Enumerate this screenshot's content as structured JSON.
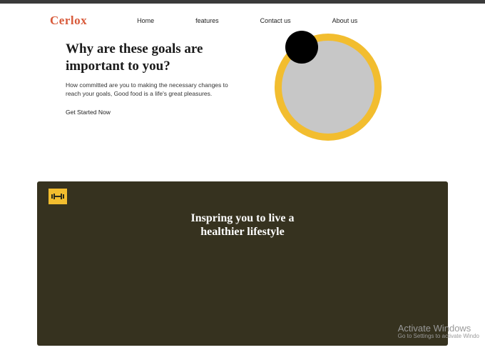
{
  "brand": "Cerlox",
  "nav": {
    "items": [
      "Home",
      "features",
      "Contact us",
      "About us"
    ]
  },
  "hero": {
    "title": "Why are these goals are important to you?",
    "subtitle": "How committed are you to making the necessary changes to reach your goals, Good food is a life's great pleasures.",
    "cta": "Get Started Now"
  },
  "section2": {
    "title": "Inspring you to live a healthier lifestyle"
  },
  "watermark": {
    "line1": "Activate Windows",
    "line2": "Go to Settings to activate Windo"
  },
  "colors": {
    "accent_orange": "#d85a3a",
    "accent_yellow": "#f2bd2f",
    "dark_olive": "#36321f",
    "circle_gray": "#c7c7c7"
  }
}
